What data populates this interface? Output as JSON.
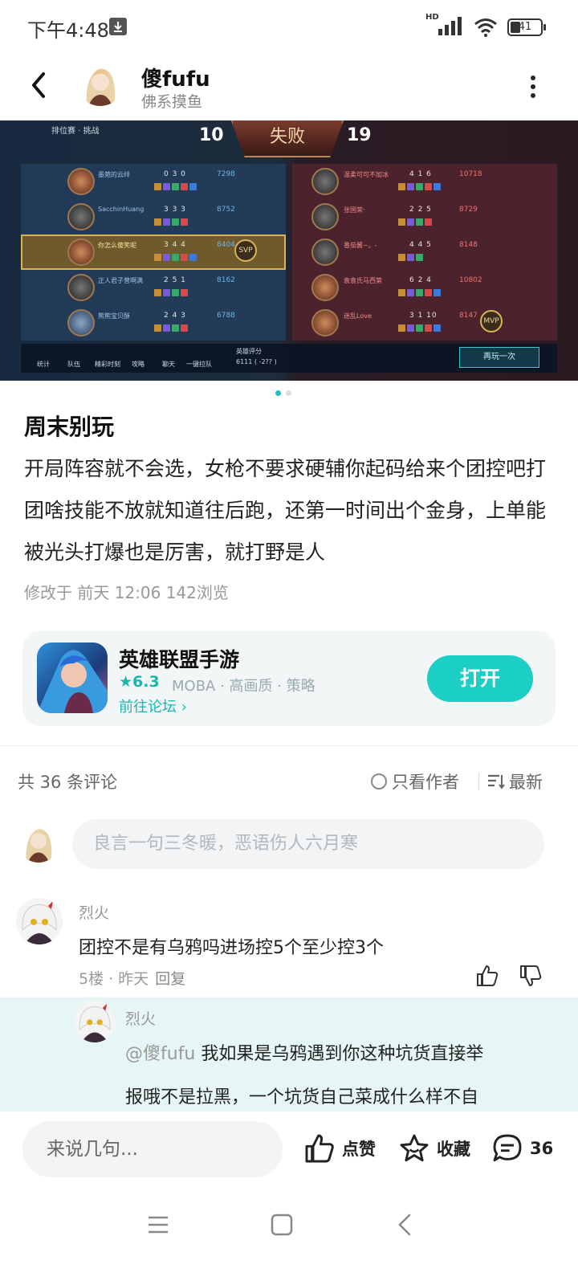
{
  "status_bar": {
    "time": "下午4:48",
    "hd": "HD",
    "battery": "41"
  },
  "header": {
    "author_name": "傻fufu",
    "author_subtitle": "佛系摸鱼"
  },
  "game_screenshot": {
    "mode": "排位赛 · 挑战",
    "blue_score": "10",
    "result": "失败",
    "red_score": "19",
    "blue_players": [
      {
        "name": "墨菀的云绊",
        "kda": "0 3 0",
        "gold": "7298",
        "level": "11"
      },
      {
        "name": "SacchinHuang",
        "kda": "3 3 3",
        "gold": "8752",
        "level": "11"
      },
      {
        "name": "你怎么傻笑呢",
        "kda": "3 4 4",
        "gold": "8404",
        "level": "11"
      },
      {
        "name": "正人君子曾啊满",
        "kda": "2 5 1",
        "gold": "8162",
        "level": "10"
      },
      {
        "name": "熊熊宝贝酥",
        "kda": "2 4 3",
        "gold": "6788",
        "level": "10"
      }
    ],
    "red_players": [
      {
        "name": "温柔可可不加冰",
        "kda": "4 1 6",
        "gold": "10718",
        "level": "12"
      },
      {
        "name": "张国荣·",
        "kda": "2 2 5",
        "gold": "8729",
        "level": "11"
      },
      {
        "name": "番茄酱~。-",
        "kda": "4 4 5",
        "gold": "8148",
        "level": "11"
      },
      {
        "name": "袁袁氏马西第",
        "kda": "6 2 4",
        "gold": "10802",
        "level": "11"
      },
      {
        "name": "迷乱Love",
        "kda": "3 1 10",
        "gold": "8147",
        "level": "10"
      }
    ],
    "svp_badge": "SVP",
    "mvp_badge": "MVP",
    "bottom_items": [
      "统计",
      "队伍",
      "精彩时刻",
      "攻略",
      "聊天",
      "一键拉队"
    ],
    "rating_label": "英雄评分",
    "rating_value": "6111 ( -2?? )",
    "play_again": "再玩一次"
  },
  "post": {
    "title": "周末别玩",
    "body": "开局阵容就不会选，女枪不要求硬辅你起码给来个团控吧打团啥技能不放就知道往后跑，还第一时间出个金身，上单能被光头打爆也是厉害，就打野是人",
    "meta": "修改于 前天 12:06  142浏览"
  },
  "game_card": {
    "name": "英雄联盟手游",
    "rating": "★6.3",
    "tags": "MOBA · 高画质 · 策略",
    "forum_link": "前往论坛",
    "open_button": "打开"
  },
  "comments_header": {
    "count": "共 36 条评论",
    "author_only": "只看作者",
    "sort": "最新"
  },
  "comment_input_placeholder": "良言一句三冬暖，恶语伤人六月寒",
  "comments": [
    {
      "name": "烈火",
      "text": "团控不是有乌鸦吗进场控5个至少控3个",
      "meta": "5楼 · 昨天",
      "reply_label": "回复"
    }
  ],
  "reply": {
    "name": "烈火",
    "mention": "@傻fufu",
    "text_line1": "我如果是乌鸦遇到你这种坑货直接举",
    "text_line2": "报哦不是拉黑，一个坑货自己菜成什么样不自"
  },
  "bottom_actions": {
    "say_placeholder": "来说几句...",
    "like": "点赞",
    "favorite": "收藏",
    "comment_count": "36"
  },
  "colors": {
    "accent": "#1ccfc4",
    "reply_bg": "#e6f6f5"
  }
}
